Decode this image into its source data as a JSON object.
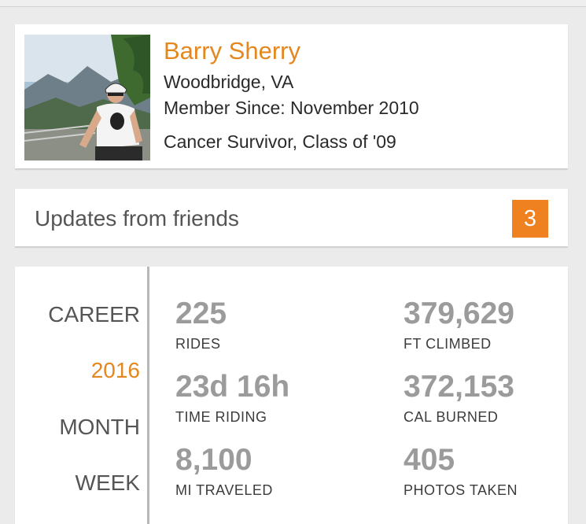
{
  "profile": {
    "name": "Barry Sherry",
    "location": "Woodbridge, VA",
    "member_since": "Member Since: November 2010",
    "tagline": "Cancer Survivor, Class of '09"
  },
  "updates": {
    "label": "Updates from friends",
    "count": "3"
  },
  "periods": [
    "CAREER",
    "2016",
    "MONTH",
    "WEEK"
  ],
  "active_period": "2016",
  "stats": [
    {
      "value": "225",
      "label": "RIDES"
    },
    {
      "value": "379,629",
      "label": "FT CLIMBED"
    },
    {
      "value": "23d 16h",
      "label": "TIME RIDING"
    },
    {
      "value": "372,153",
      "label": "CAL BURNED"
    },
    {
      "value": "8,100",
      "label": "MI TRAVELED"
    },
    {
      "value": "405",
      "label": "PHOTOS TAKEN"
    }
  ],
  "colors": {
    "accent": "#e5871f",
    "badge": "#f08120",
    "background": "#ebebeb",
    "stat_value": "#9b9b9b"
  }
}
